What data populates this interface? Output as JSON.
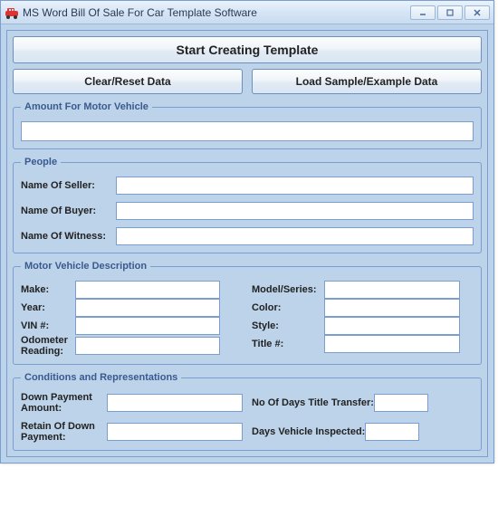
{
  "window": {
    "title": "MS Word Bill Of Sale For Car Template Software"
  },
  "buttons": {
    "start": "Start Creating Template",
    "clear": "Clear/Reset Data",
    "load": "Load Sample/Example Data"
  },
  "groups": {
    "amount": {
      "legend": "Amount For Motor Vehicle",
      "value": ""
    },
    "people": {
      "legend": "People",
      "seller_label": "Name Of Seller:",
      "seller_value": "",
      "buyer_label": "Name Of Buyer:",
      "buyer_value": "",
      "witness_label": "Name Of Witness:",
      "witness_value": ""
    },
    "vehicle": {
      "legend": "Motor Vehicle Description",
      "make_label": "Make:",
      "make_value": "",
      "model_label": "Model/Series:",
      "model_value": "",
      "year_label": "Year:",
      "year_value": "",
      "color_label": "Color:",
      "color_value": "",
      "vin_label": "VIN #:",
      "vin_value": "",
      "style_label": "Style:",
      "style_value": "",
      "odometer_label": "Odometer Reading:",
      "odometer_value": "",
      "title_label": "Title #:",
      "title_value": ""
    },
    "conditions": {
      "legend": "Conditions and Representations",
      "down_label": "Down Payment Amount:",
      "down_value": "",
      "days_title_label": "No Of Days Title Transfer:",
      "days_title_value": "",
      "retain_label": "Retain Of Down Payment:",
      "retain_value": "",
      "days_inspected_label": "Days Vehicle Inspected:",
      "days_inspected_value": ""
    }
  }
}
